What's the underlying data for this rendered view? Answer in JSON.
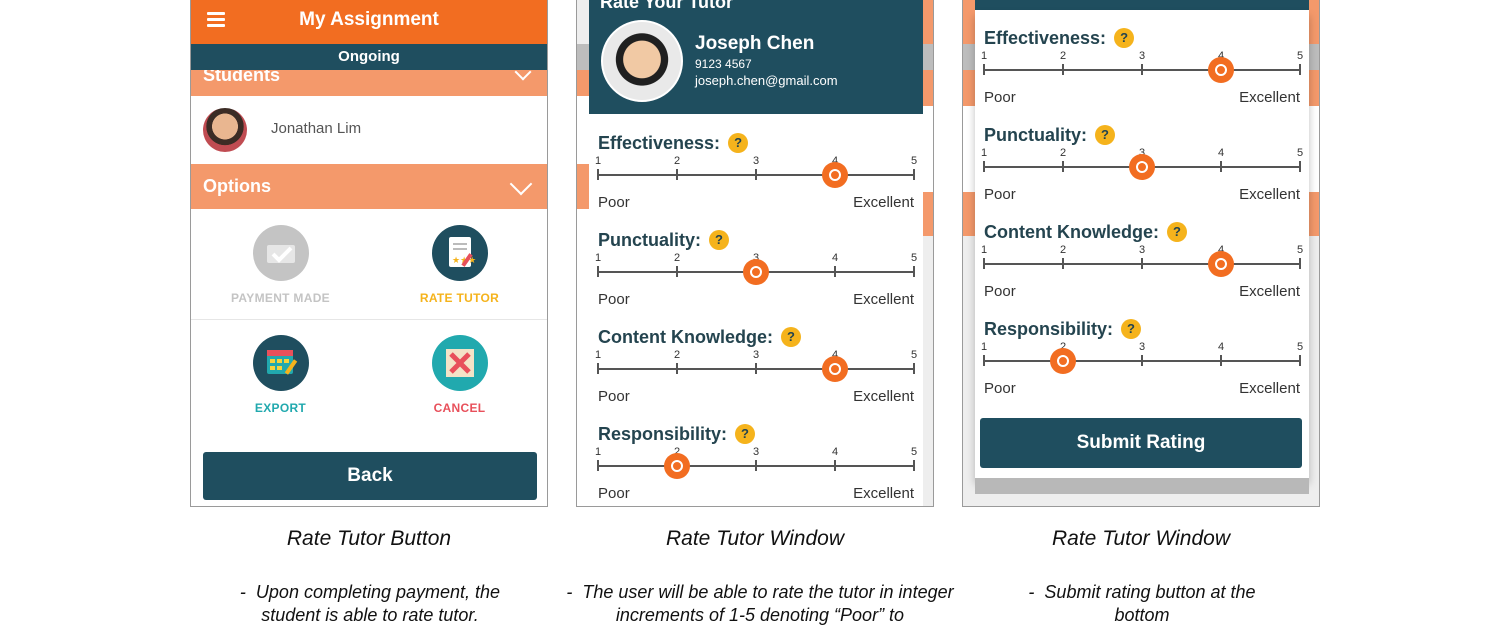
{
  "panel1": {
    "title": "My Assignment",
    "status": "Ongoing",
    "students_section": "Students",
    "student_name": "Jonathan Lim",
    "options_section": "Options",
    "options": [
      {
        "label": "PAYMENT MADE",
        "icon": "payment-made-icon",
        "color": "#c4c4c4"
      },
      {
        "label": "RATE TUTOR",
        "icon": "rate-tutor-icon",
        "color": "#f5b31c"
      },
      {
        "label": "EXPORT",
        "icon": "export-calendar-icon",
        "color": "#21a9ae"
      },
      {
        "label": "CANCEL",
        "icon": "cancel-icon",
        "color": "#e8505b"
      }
    ],
    "back_label": "Back"
  },
  "panel2": {
    "header_title": "Rate Your Tutor",
    "tutor": {
      "name": "Joseph Chen",
      "phone": "9123 4567",
      "email": "joseph.chen@gmail.com"
    }
  },
  "scale": {
    "numbers": [
      "1",
      "2",
      "3",
      "4",
      "5"
    ],
    "low": "Poor",
    "high": "Excellent",
    "help": "?"
  },
  "ratings_panel2": [
    {
      "label": "Effectiveness:",
      "value": 4
    },
    {
      "label": "Punctuality:",
      "value": 3
    },
    {
      "label": "Content Knowledge:",
      "value": 4
    },
    {
      "label": "Responsibility:",
      "value": 2
    }
  ],
  "ratings_panel3": [
    {
      "label": "Effectiveness:",
      "value": 4
    },
    {
      "label": "Punctuality:",
      "value": 3
    },
    {
      "label": "Content Knowledge:",
      "value": 4
    },
    {
      "label": "Responsibility:",
      "value": 2
    }
  ],
  "panel3": {
    "submit_label": "Submit Rating"
  },
  "captions": [
    {
      "title": "Rate Tutor Button",
      "desc": [
        "-",
        "Upon completing payment, the",
        "student is able to rate tutor."
      ]
    },
    {
      "title": "Rate Tutor Window",
      "desc": [
        "-",
        "The user will be able to rate the tutor in integer",
        "increments of 1-5 denoting “Poor” to"
      ]
    },
    {
      "title": "Rate Tutor Window",
      "desc": [
        "-",
        "Submit rating button at the",
        "bottom"
      ]
    }
  ],
  "colors": {
    "brand_orange": "#f26d21",
    "light_orange": "#f4996b",
    "dark_teal": "#1f4e5f",
    "help_yellow": "#f5b31c"
  }
}
